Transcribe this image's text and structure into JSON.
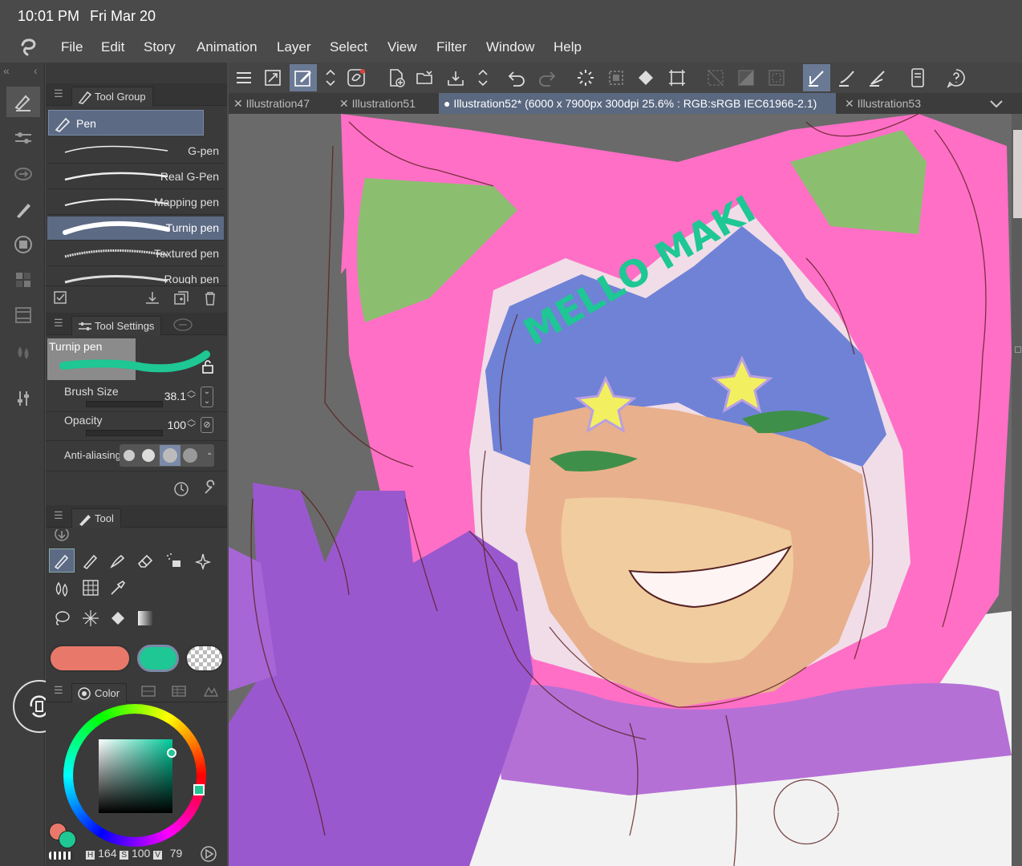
{
  "status": {
    "time": "10:01 PM",
    "date": "Fri Mar 20"
  },
  "menu": [
    "File",
    "Edit",
    "Story",
    "Animation",
    "Layer",
    "Select",
    "View",
    "Filter",
    "Window",
    "Help"
  ],
  "tool_group": {
    "tab_label": "Tool Group",
    "selected_group": "Pen",
    "brushes": [
      "G-pen",
      "Real G-Pen",
      "Mapping pen",
      "Turnip pen",
      "Textured pen",
      "Rough pen"
    ],
    "selected_brush": "Turnip pen"
  },
  "tool_settings": {
    "tab_label": "Tool Settings",
    "preview_label": "Turnip pen",
    "brush_size_label": "Brush Size",
    "brush_size_value": "38.1",
    "opacity_label": "Opacity",
    "opacity_value": "100",
    "antialias_label": "Anti-aliasing"
  },
  "tool_panel": {
    "tab_label": "Tool"
  },
  "colors": {
    "main": "#e8796a",
    "sub": "#1ec793",
    "accent_tab": "#5a6880"
  },
  "color_panel": {
    "tab_label": "Color",
    "h_label": "H",
    "h_value": "164",
    "s_label": "S",
    "s_value": "100",
    "v_label": "V",
    "v_value": "79"
  },
  "canvas_tabs": [
    {
      "label": "Illustration47",
      "active": false
    },
    {
      "label": "Illustration51",
      "active": false
    },
    {
      "label": "Illustration52* (6000 x 7900px 300dpi 25.6% : RGB:sRGB IEC61966-2.1)",
      "active": true
    },
    {
      "label": "Illustration53",
      "active": false
    }
  ],
  "artwork_text": "MELLO MAKI"
}
